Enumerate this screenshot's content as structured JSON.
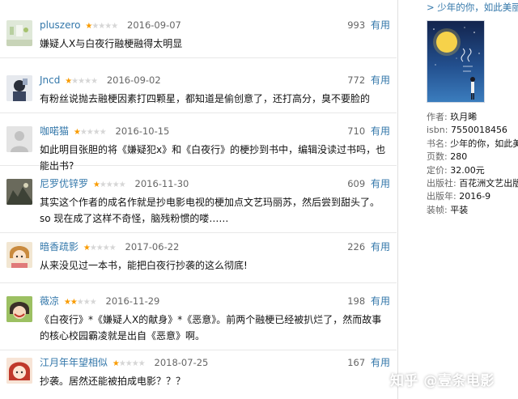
{
  "reviews": [
    {
      "user": "pluszero",
      "rating": 1,
      "date": "2016-09-07",
      "votes": "993",
      "useful_label": "有用",
      "text": "嫌疑人X与白夜行融梗融得太明显"
    },
    {
      "user": "Jncd",
      "rating": 1,
      "date": "2016-09-02",
      "votes": "772",
      "useful_label": "有用",
      "text": "有粉丝说抛去融梗因素打四颗星，都知道是偷创意了，还打高分，臭不要脸的"
    },
    {
      "user": "咖喏猫",
      "rating": 1,
      "date": "2016-10-15",
      "votes": "710",
      "useful_label": "有用",
      "text": "如此明目张胆的将《嫌疑犯x》和《白夜行》的梗抄到书中，编辑没读过书吗，也能出书?"
    },
    {
      "user": "尼罗优锌罗",
      "rating": 1,
      "date": "2016-11-30",
      "votes": "609",
      "useful_label": "有用",
      "text": "其实这个作者的成名作就是抄电影电视的梗加点文艺玛丽苏，然后尝到甜头了。so 现在成了这样不奇怪，脑残粉惯的喽……"
    },
    {
      "user": "暗香疏影",
      "rating": 1,
      "date": "2017-06-22",
      "votes": "226",
      "useful_label": "有用",
      "text": "从来没见过一本书，能把白夜行抄袭的这么彻底!"
    },
    {
      "user": "薇凉",
      "rating": 2,
      "date": "2016-11-29",
      "votes": "198",
      "useful_label": "有用",
      "text": "《白夜行》*《嫌疑人X的献身》*《恶意》。前两个融梗已经被扒烂了，然而故事的核心校园霸凌就是出自《恶意》啊。"
    },
    {
      "user": "江月年年望相似",
      "rating": 1,
      "date": "2018-07-25",
      "votes": "167",
      "useful_label": "有用",
      "text": "抄袭。居然还能被拍成电影？？？"
    }
  ],
  "sidebar": {
    "link": "> 少年的你，如此美丽",
    "info": [
      {
        "k": "作者:",
        "v": " 玖月晞"
      },
      {
        "k": "isbn:",
        "v": " 7550018456"
      },
      {
        "k": "书名:",
        "v": " 少年的你，如此美丽"
      },
      {
        "k": "页数:",
        "v": " 280"
      },
      {
        "k": "定价:",
        "v": " 32.00元"
      },
      {
        "k": "出版社:",
        "v": " 百花洲文艺出版社"
      },
      {
        "k": "出版年:",
        "v": " 2016-9"
      },
      {
        "k": "装帧:",
        "v": " 平装"
      }
    ]
  },
  "watermark": "知乎 @壹条电影",
  "colors": {
    "link": "#3377aa",
    "star_on": "#f99b01",
    "star_off": "#d6d6d6"
  }
}
